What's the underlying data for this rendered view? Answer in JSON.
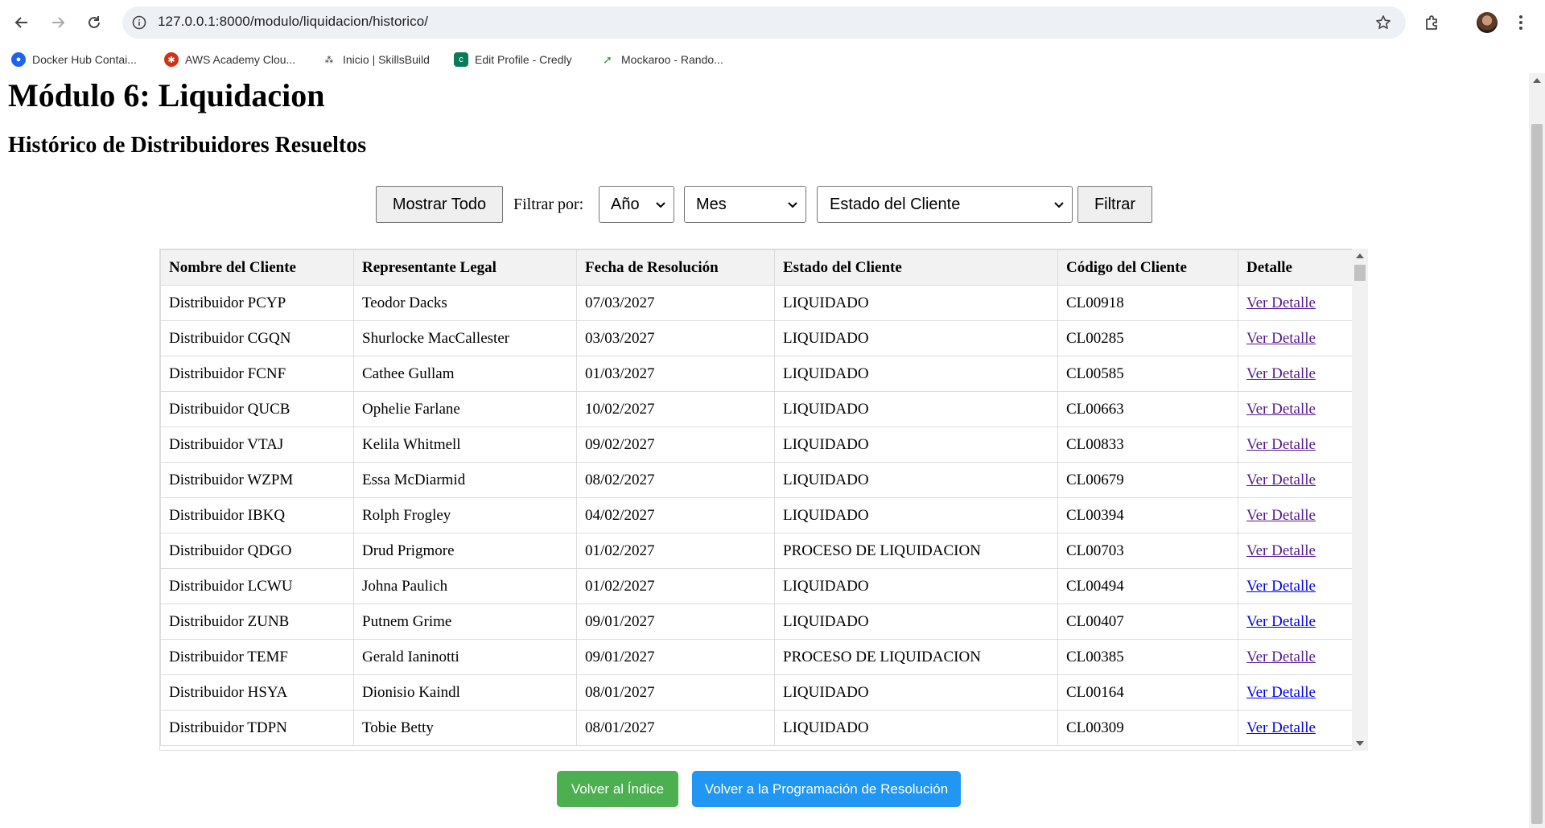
{
  "browser": {
    "url": "127.0.0.1:8000/modulo/liquidacion/historico/",
    "bookmarks": [
      {
        "label": "Docker Hub Contai...",
        "icon": "docker-icon",
        "color": "#1d63ed"
      },
      {
        "label": "AWS Academy Clou...",
        "icon": "aws-academy-icon",
        "color": "#d13212"
      },
      {
        "label": "Inicio | SkillsBuild",
        "icon": "skillsbuild-icon",
        "color": "#333333"
      },
      {
        "label": "Edit Profile - Credly",
        "icon": "credly-icon",
        "color": "#0a7a5a"
      },
      {
        "label": "Mockaroo - Rando...",
        "icon": "mockaroo-icon",
        "color": "#2e9e3a"
      }
    ]
  },
  "page": {
    "title": "Módulo 6: Liquidacion",
    "subtitle": "Histórico de Distribuidores Resueltos"
  },
  "filters": {
    "show_all_label": "Mostrar Todo",
    "filter_by_label": "Filtrar por:",
    "year_select": "Año",
    "month_select": "Mes",
    "status_select": "Estado del Cliente",
    "filter_button": "Filtrar"
  },
  "table": {
    "headers": [
      "Nombre del Cliente",
      "Representante Legal",
      "Fecha de Resolución",
      "Estado del Cliente",
      "Código del Cliente",
      "Detalle"
    ],
    "rows": [
      [
        "Distribuidor PCYP",
        "Teodor Dacks",
        "07/03/2027",
        "LIQUIDADO",
        "CL00918",
        "Ver Detalle"
      ],
      [
        "Distribuidor CGQN",
        "Shurlocke MacCallester",
        "03/03/2027",
        "LIQUIDADO",
        "CL00285",
        "Ver Detalle"
      ],
      [
        "Distribuidor FCNF",
        "Cathee Gullam",
        "01/03/2027",
        "LIQUIDADO",
        "CL00585",
        "Ver Detalle"
      ],
      [
        "Distribuidor QUCB",
        "Ophelie Farlane",
        "10/02/2027",
        "LIQUIDADO",
        "CL00663",
        "Ver Detalle"
      ],
      [
        "Distribuidor VTAJ",
        "Kelila Whitmell",
        "09/02/2027",
        "LIQUIDADO",
        "CL00833",
        "Ver Detalle"
      ],
      [
        "Distribuidor WZPM",
        "Essa McDiarmid",
        "08/02/2027",
        "LIQUIDADO",
        "CL00679",
        "Ver Detalle"
      ],
      [
        "Distribuidor IBKQ",
        "Rolph Frogley",
        "04/02/2027",
        "LIQUIDADO",
        "CL00394",
        "Ver Detalle"
      ],
      [
        "Distribuidor QDGO",
        "Drud Prigmore",
        "01/02/2027",
        "PROCESO DE LIQUIDACION",
        "CL00703",
        "Ver Detalle"
      ],
      [
        "Distribuidor LCWU",
        "Johna Paulich",
        "01/02/2027",
        "LIQUIDADO",
        "CL00494",
        "Ver Detalle"
      ],
      [
        "Distribuidor ZUNB",
        "Putnem Grime",
        "09/01/2027",
        "LIQUIDADO",
        "CL00407",
        "Ver Detalle"
      ],
      [
        "Distribuidor TEMF",
        "Gerald Ianinotti",
        "09/01/2027",
        "PROCESO DE LIQUIDACION",
        "CL00385",
        "Ver Detalle"
      ],
      [
        "Distribuidor HSYA",
        "Dionisio Kaindl",
        "08/01/2027",
        "LIQUIDADO",
        "CL00164",
        "Ver Detalle"
      ],
      [
        "Distribuidor TDPN",
        "Tobie Betty",
        "08/01/2027",
        "LIQUIDADO",
        "CL00309",
        "Ver Detalle"
      ]
    ],
    "visited_rows": [
      0,
      1,
      2,
      3,
      4,
      5,
      6,
      7,
      10
    ],
    "link_color": "#0000ee",
    "visited_color": "#551a8b"
  },
  "actions": {
    "back_index_label": "Volver al Índice",
    "back_schedule_label": "Volver a la Programación de Resolución",
    "green": "#4caf50",
    "blue": "#2196f3"
  }
}
